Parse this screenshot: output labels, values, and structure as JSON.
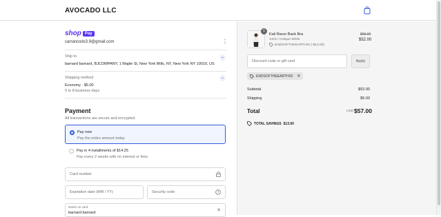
{
  "header": {
    "brand": "AVOCADO LLC",
    "icon": "shopping-bag-icon"
  },
  "express": {
    "shop_label": "shop",
    "pay_label": "Pay",
    "email": "carrancods3.9@gmail.com"
  },
  "ship_to": {
    "label": "Ship to",
    "value": "barnard barnard, BJCOMPANY, 1 Maple St, New York Mills, NY, New York NY 10010, US"
  },
  "shipping_method": {
    "label": "Shipping method",
    "value": "Economy · $5.00",
    "eta": "5 to 8 business days"
  },
  "payment": {
    "title": "Payment",
    "subtitle": "All transactions are secure and encrypted.",
    "options": [
      {
        "title": "Pay now",
        "subtitle": "Pay the entire amount today",
        "selected": true
      },
      {
        "title": "Pay in 4 installments of $14.25",
        "subtitle": "Pay every 2 weeks with no interest or fees",
        "selected": false
      }
    ],
    "card_number_placeholder": "Card number",
    "expiration_placeholder": "Expiration date (MM / YY)",
    "security_placeholder": "Security code",
    "name_label": "Name on card",
    "name_value": "barnard barnard"
  },
  "summary": {
    "qty": "1",
    "product_name": "Kali Racer Back Bra",
    "variant": "XS/S / Antique White",
    "discount_line": "ENDSOFTHEEARTH20 (-$13.00)",
    "old_price": "$65.00",
    "new_price": "$52.00",
    "discount_placeholder": "Discount code or gift card",
    "apply_label": "Apply",
    "chip_code": "ENDSOFTHEEARTH20",
    "subtotal_label": "Subtotal",
    "subtotal_value": "$52.00",
    "shipping_label": "Shipping",
    "shipping_value": "$5.00",
    "total_label": "Total",
    "currency": "USD",
    "total_value": "$57.00",
    "savings_label": "TOTAL SAVINGS",
    "savings_value": "$13.00"
  },
  "colors": {
    "shop_pay": "#5a31f4",
    "accent": "#2f5bd7",
    "panel_bg": "#f5f5f5"
  }
}
